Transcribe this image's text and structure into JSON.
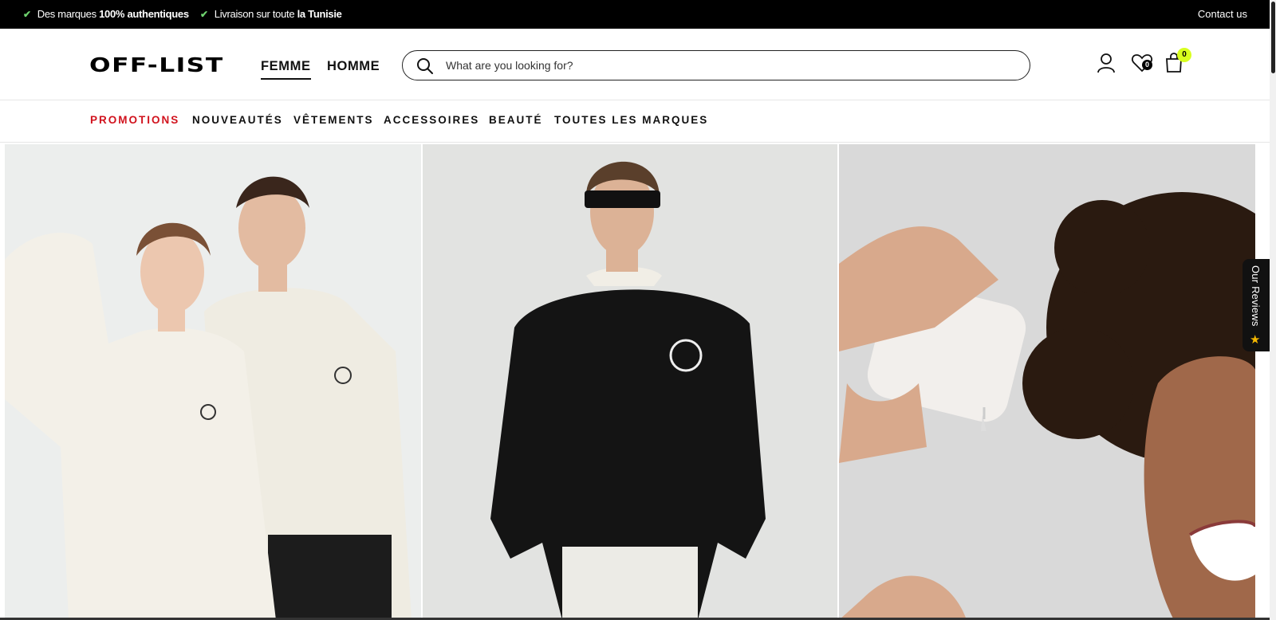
{
  "announcement": {
    "item1_prefix": "Des marques",
    "item1_bold": "100% authentiques",
    "item2_prefix": "Livraison sur toute",
    "item2_bold": "la Tunisie",
    "contact": "Contact us"
  },
  "header": {
    "logo": "OFF-LIST",
    "gender_tabs": [
      "FEMME",
      "HOMME"
    ],
    "active_gender": "FEMME",
    "search_placeholder": "What are you looking for?",
    "wishlist_count": "0",
    "cart_count": "0",
    "cart_badge_color": "#d8ff1e"
  },
  "nav": {
    "items": [
      "PROMOTIONS",
      "NOUVEAUTÉS",
      "VÊTEMENTS",
      "ACCESSOIRES",
      "BEAUTÉ",
      "TOUTES LES MARQUES"
    ],
    "promo_color": "#d1121d"
  },
  "hero": {
    "panels": [
      "knit-sweaters-couple-photo",
      "black-sweatshirt-model-photo",
      "beauty-product-curly-hair-photo"
    ]
  },
  "reviews_tab": {
    "label": "Our Reviews",
    "icon": "star-icon"
  }
}
